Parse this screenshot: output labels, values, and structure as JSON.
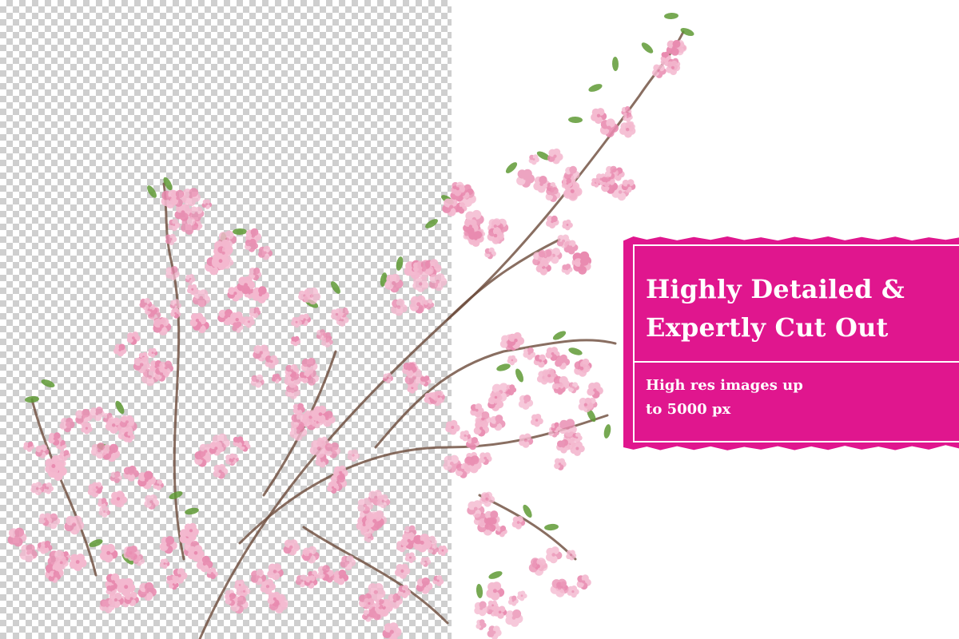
{
  "theme": {
    "accent": "#e0168e",
    "checker": "#cfcfcf",
    "blossom": "#f4b8cf",
    "blossom_deep": "#e98bb0",
    "branch": "#6b4a3a",
    "leaf": "#5f9a35"
  },
  "card": {
    "heading_line1": "Highly Detailed &",
    "heading_line2": "Expertly Cut Out",
    "body_line1": "High res images up",
    "body_line2": "to 5000 px"
  }
}
